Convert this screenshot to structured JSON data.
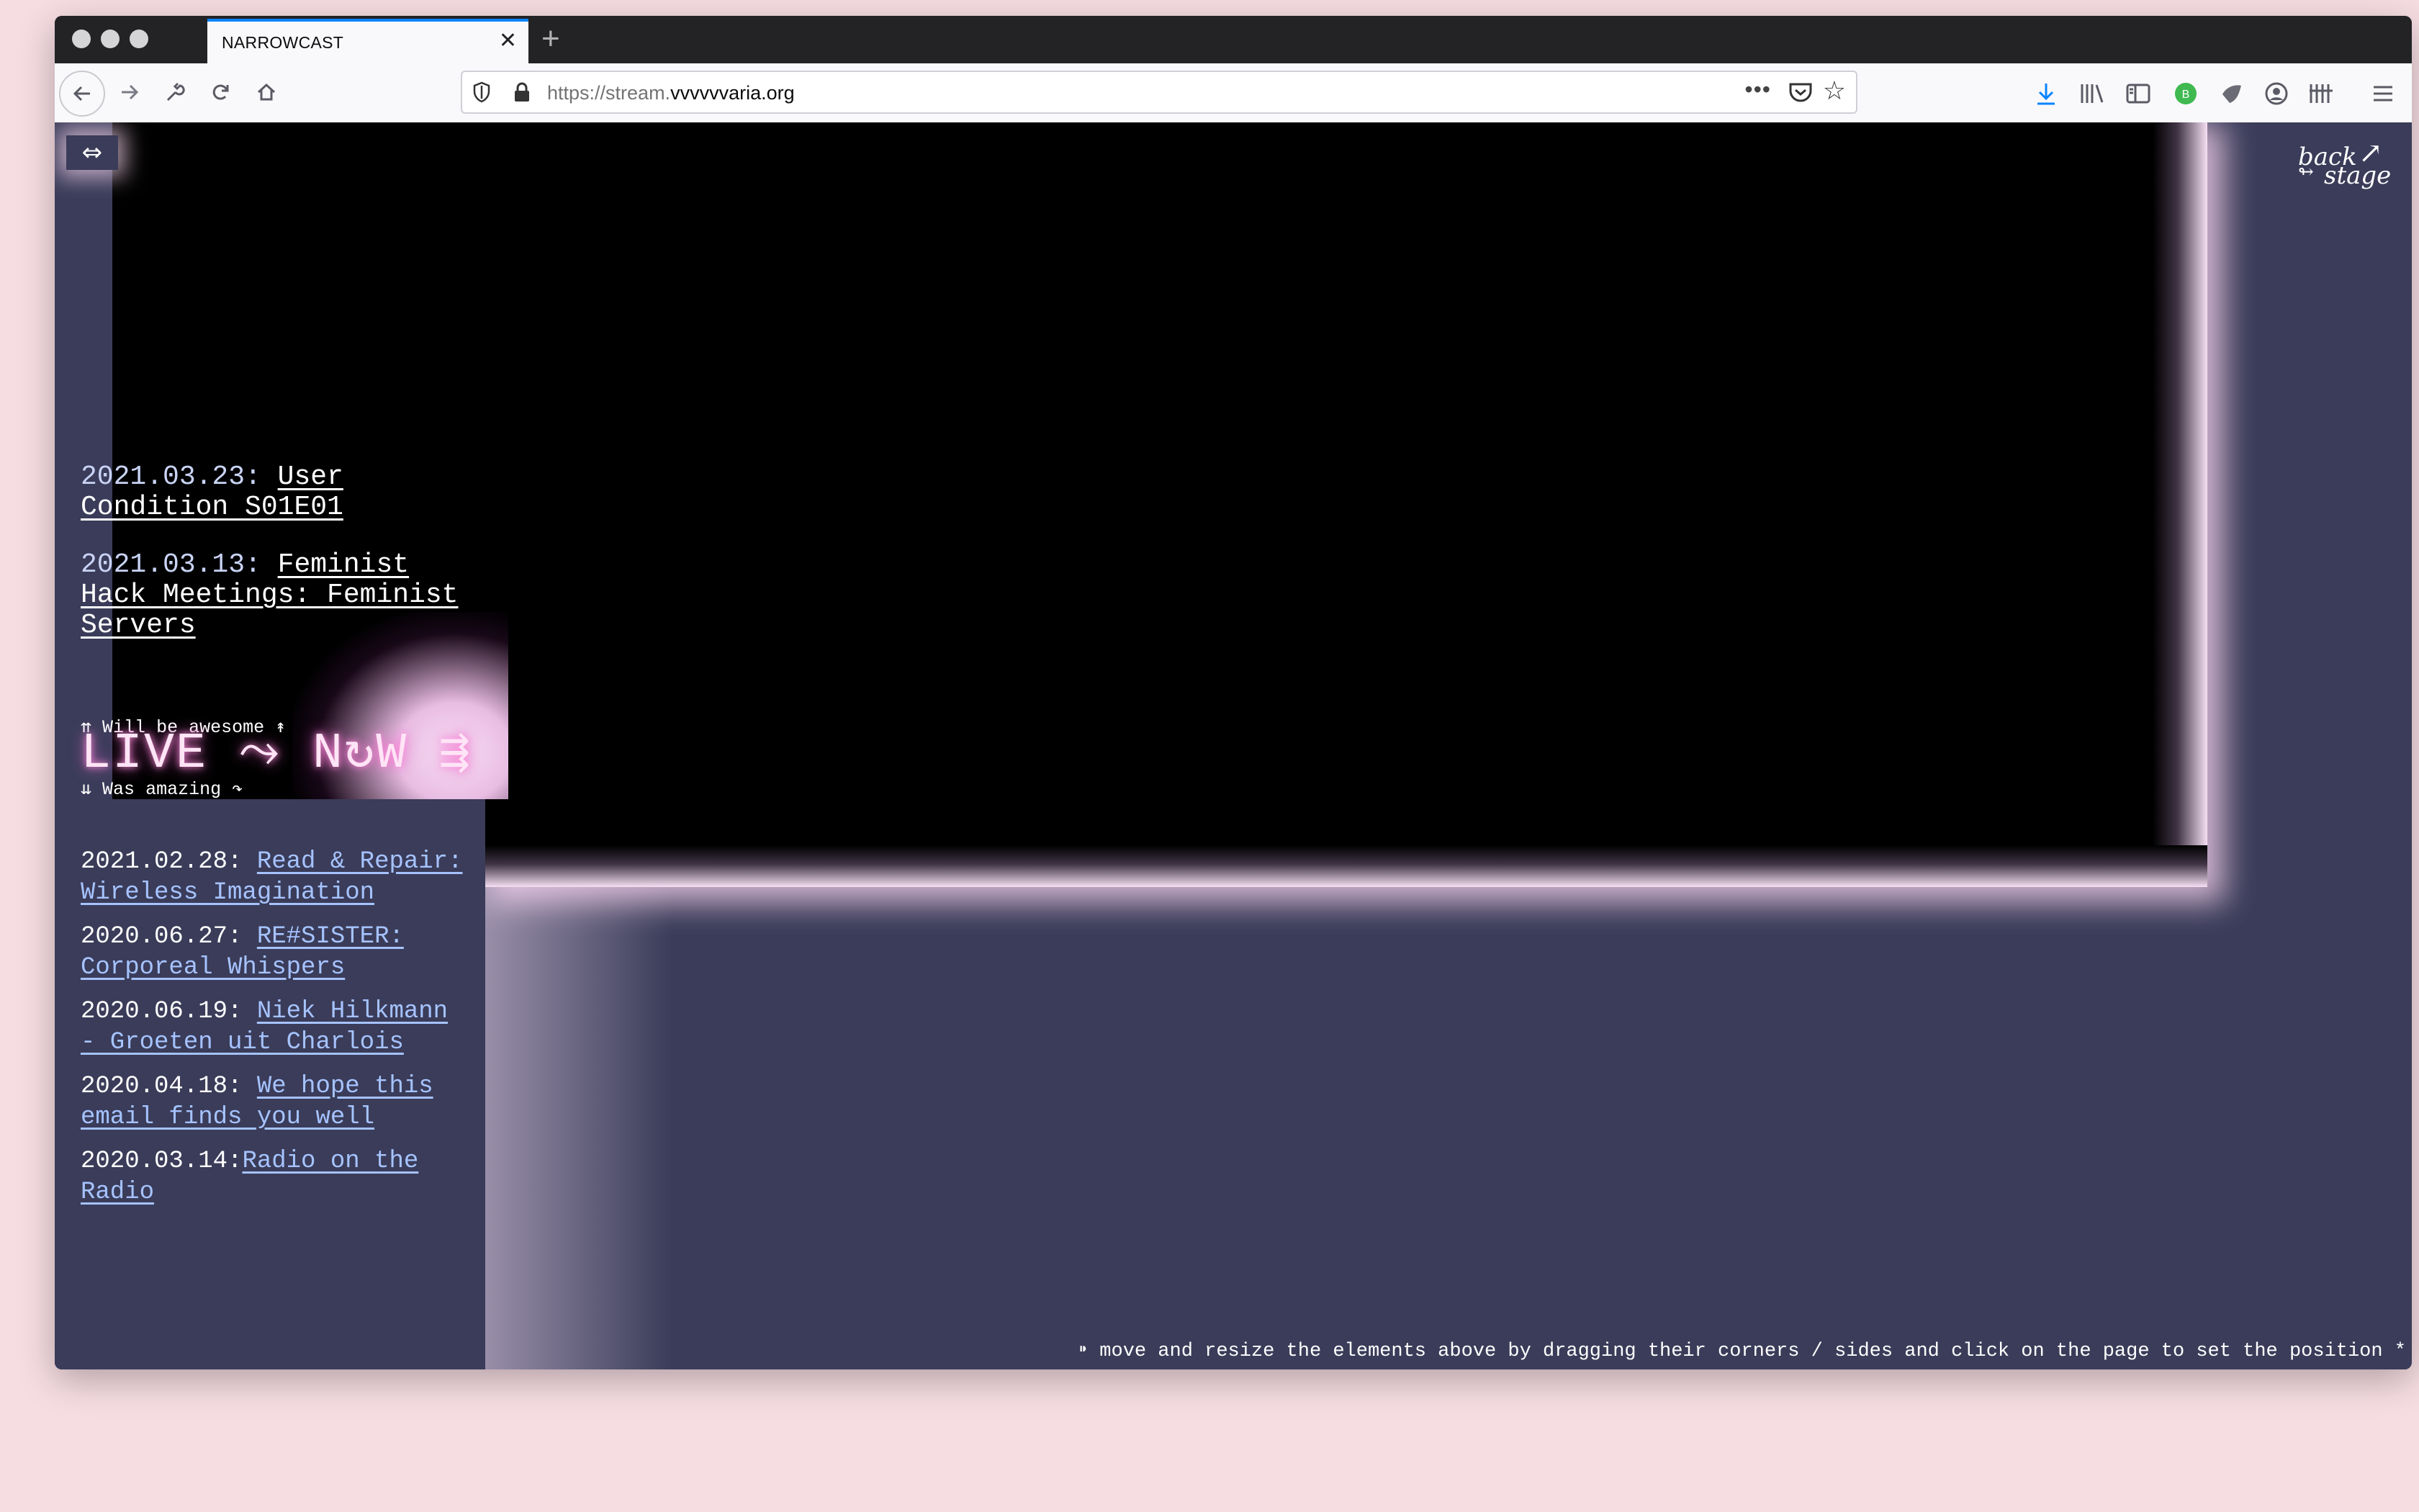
{
  "browser": {
    "tab_title": "NARROWCAST",
    "tab_close": "✕",
    "new_tab": "+",
    "url_prefix": "https://stream.",
    "url_domain": "vvvvvvaria.org",
    "url_more": "•••"
  },
  "sidebar": {
    "toggle_label": "⇔",
    "upcoming": [
      {
        "date": "2021.03.23:",
        "title": "User Condition S01E01"
      },
      {
        "date": "2021.03.13:",
        "title": "Feminist Hack Meetings: Feminist Servers"
      }
    ],
    "live": {
      "before": "⇈ Will be awesome ↟",
      "title": "LIVE ⤳ N↻W ⇶",
      "after": "⇊ Was amazing ↷"
    },
    "past": [
      {
        "date": "2021.02.28:",
        "title": "Read & Repair: Wireless Imagination"
      },
      {
        "date": "2020.06.27:",
        "title": "RE#SISTER: Corporeal Whispers"
      },
      {
        "date": "2020.06.19:",
        "title": "Niek Hilkmann - Groeten uit Charlois"
      },
      {
        "date": "2020.04.18:",
        "title": "We hope this email finds you well"
      },
      {
        "date": "2020.03.14:",
        "title": "Radio on the Radio"
      }
    ]
  },
  "backstage": {
    "word1": "back",
    "arrow": "↗",
    "symbol": "↬",
    "word2": "stage"
  },
  "footer_hint": "⁍ move and resize the elements above by dragging their corners / sides and click on the page to set the position *"
}
